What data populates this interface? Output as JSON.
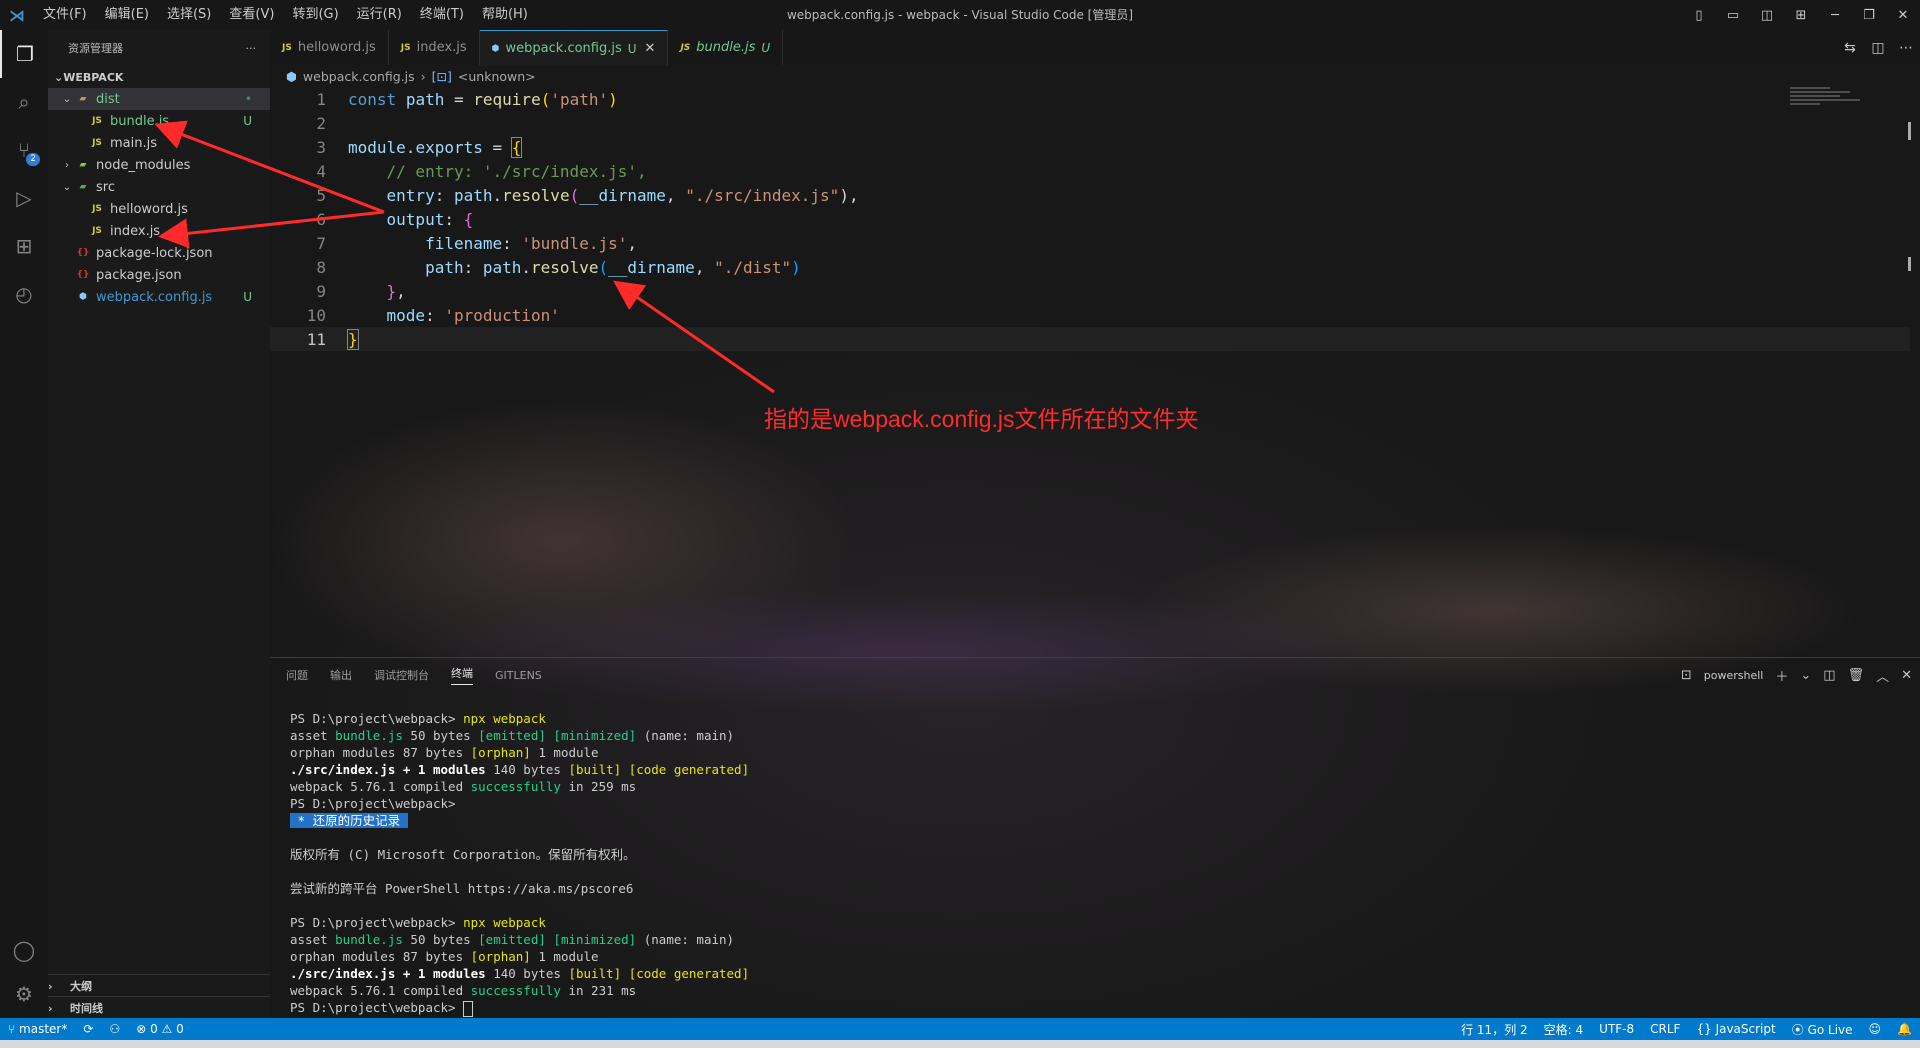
{
  "titlebar": {
    "menus": [
      "文件(F)",
      "编辑(E)",
      "选择(S)",
      "查看(V)",
      "转到(G)",
      "运行(R)",
      "终端(T)",
      "帮助(H)"
    ],
    "title": "webpack.config.js - webpack - Visual Studio Code [管理员]"
  },
  "activity": {
    "scm_badge": "2"
  },
  "sidebar": {
    "header": "资源管理器",
    "more": "···",
    "section": "WEBPACK",
    "tree": [
      {
        "label": "dist",
        "type": "folder",
        "status": "•"
      },
      {
        "label": "bundle.js",
        "type": "js",
        "status": "U"
      },
      {
        "label": "main.js",
        "type": "js",
        "status": ""
      },
      {
        "label": "node_modules",
        "type": "folder",
        "status": ""
      },
      {
        "label": "src",
        "type": "folder",
        "status": ""
      },
      {
        "label": "helloword.js",
        "type": "js",
        "status": ""
      },
      {
        "label": "index.js",
        "type": "js",
        "status": ""
      },
      {
        "label": "package-lock.json",
        "type": "json",
        "status": ""
      },
      {
        "label": "package.json",
        "type": "json",
        "status": ""
      },
      {
        "label": "webpack.config.js",
        "type": "config",
        "status": "U"
      }
    ],
    "outline": "大纲",
    "timeline": "时间线"
  },
  "tabs": [
    {
      "label": "helloword.js",
      "status": ""
    },
    {
      "label": "index.js",
      "status": ""
    },
    {
      "label": "webpack.config.js",
      "status": "U"
    },
    {
      "label": "bundle.js",
      "status": "U"
    }
  ],
  "file_icon_js": "JS",
  "file_icon_json": "{}",
  "breadcrumb": {
    "file": "webpack.config.js",
    "symbol": "<unknown>"
  },
  "code": {
    "line_numbers": [
      "1",
      "2",
      "3",
      "4",
      "5",
      "6",
      "7",
      "8",
      "9",
      "10",
      "11"
    ],
    "l1": {
      "a": "const",
      "b": "path",
      "c": "=",
      "d": "require",
      "e": "(",
      "f": "'path'",
      "g": ")"
    },
    "l3": {
      "a": "module",
      "b": ".",
      "c": "exports",
      "d": " = ",
      "e": "{"
    },
    "l4": "// entry: './src/index.js',",
    "l5": {
      "a": "entry",
      "b": ": ",
      "c": "path",
      "d": ".",
      "e": "resolve",
      "f": "(",
      "g": "__dirname",
      "h": ", ",
      "i": "\"./src/index.js\"",
      "j": "),"
    },
    "l6": {
      "a": "output",
      "b": ": ",
      "c": "{"
    },
    "l7": {
      "a": "filename",
      "b": ": ",
      "c": "'bundle.js'",
      "d": ","
    },
    "l8": {
      "a": "path",
      "b": ": ",
      "c": "path",
      "d": ".",
      "e": "resolve",
      "f": "(",
      "g": "__dirname",
      "h": ", ",
      "i": "\"./dist\"",
      "j": ")"
    },
    "l9": {
      "a": "}",
      "b": ","
    },
    "l10": {
      "a": "mode",
      "b": ": ",
      "c": "'production'"
    },
    "l11": "}"
  },
  "annotation": "指的是webpack.config.js文件所在的文件夹",
  "panel": {
    "tabs": [
      "问题",
      "输出",
      "调试控制台",
      "终端",
      "GITLENS"
    ],
    "active_tab": "终端",
    "shell": "powershell",
    "terminal": {
      "p1": "PS D:\\project\\webpack> ",
      "cmd": "npx webpack",
      "asset1": "asset ",
      "asset2": "bundle.js",
      "asset3": " 50 bytes ",
      "asset4": "[emitted]",
      "asset5": " ",
      "asset6": "[minimized]",
      "asset7": " (name: main)",
      "orph1": "orphan modules 87 bytes ",
      "orph2": "[orphan]",
      "orph3": " 1 module",
      "mod1": "./src/index.js + 1 modules",
      "mod2": " 140 bytes ",
      "mod3": "[built]",
      "mod4": " ",
      "mod5": "[code generated]",
      "comp1a": "webpack 5.76.1 compiled ",
      "comp1b": "successfully",
      "comp1c": " in 259 ms",
      "p2": "PS D:\\project\\webpack>",
      "hist": " * 还原的历史记录 ",
      "copyright": "版权所有 (C) Microsoft Corporation。保留所有权利。",
      "tryps": "尝试新的跨平台 PowerShell https://aka.ms/pscore6",
      "comp2c": " in 231 ms"
    }
  },
  "statusbar": {
    "branch": "master*",
    "errors": "0",
    "warnings": "0",
    "position": "行 11，列 2",
    "spaces": "空格: 4",
    "encoding": "UTF-8",
    "eol": "CRLF",
    "language": "JavaScript",
    "golive": "Go Live"
  },
  "colors": {
    "accent": "#007acc",
    "annotation": "#ff2b2b",
    "untracked": "#73c991"
  }
}
